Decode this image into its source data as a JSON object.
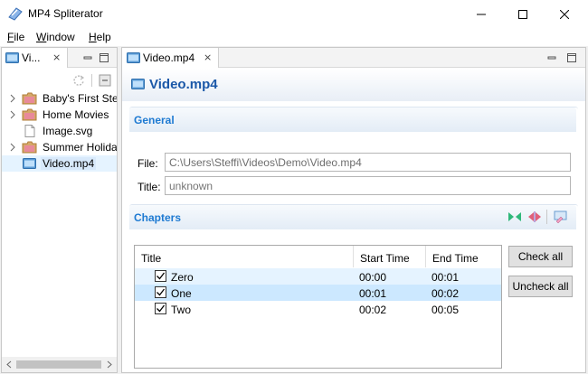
{
  "window": {
    "title": "MP4 Spliterator"
  },
  "menu": {
    "file": {
      "first": "F",
      "rest": "ile"
    },
    "window": {
      "first": "W",
      "rest": "indow"
    },
    "help": {
      "first": "H",
      "rest": "elp"
    }
  },
  "left_view": {
    "tab_label": "Vi...",
    "tree": [
      {
        "label": "Baby's First Steps",
        "type": "folder",
        "expandable": true
      },
      {
        "label": "Home Movies",
        "type": "folder",
        "expandable": true
      },
      {
        "label": "Image.svg",
        "type": "file",
        "expandable": false
      },
      {
        "label": "Summer Holiday",
        "type": "folder",
        "expandable": true
      },
      {
        "label": "Video.mp4",
        "type": "video",
        "expandable": false,
        "selected": true
      }
    ]
  },
  "editor": {
    "tab_label": "Video.mp4",
    "form_title": "Video.mp4",
    "general": {
      "title": "General",
      "file_label": "File:",
      "file_value": "C:\\Users\\Steffi\\Videos\\Demo\\Video.mp4",
      "title_label": "Title:",
      "title_placeholder": "unknown"
    },
    "chapters": {
      "title": "Chapters",
      "columns": [
        "Title",
        "Start Time",
        "End Time"
      ],
      "rows": [
        {
          "title": "Zero",
          "start": "00:00",
          "end": "00:01",
          "checked": true
        },
        {
          "title": "One",
          "start": "00:01",
          "end": "00:02",
          "checked": true
        },
        {
          "title": "Two",
          "start": "00:02",
          "end": "00:05",
          "checked": true
        }
      ],
      "check_all": "Check all",
      "uncheck_all": "Uncheck all"
    }
  },
  "colors": {
    "accent": "#1b58a8",
    "section_title": "#1e7ad2",
    "selection": "#cce8ff",
    "hover": "#e5f3ff"
  }
}
